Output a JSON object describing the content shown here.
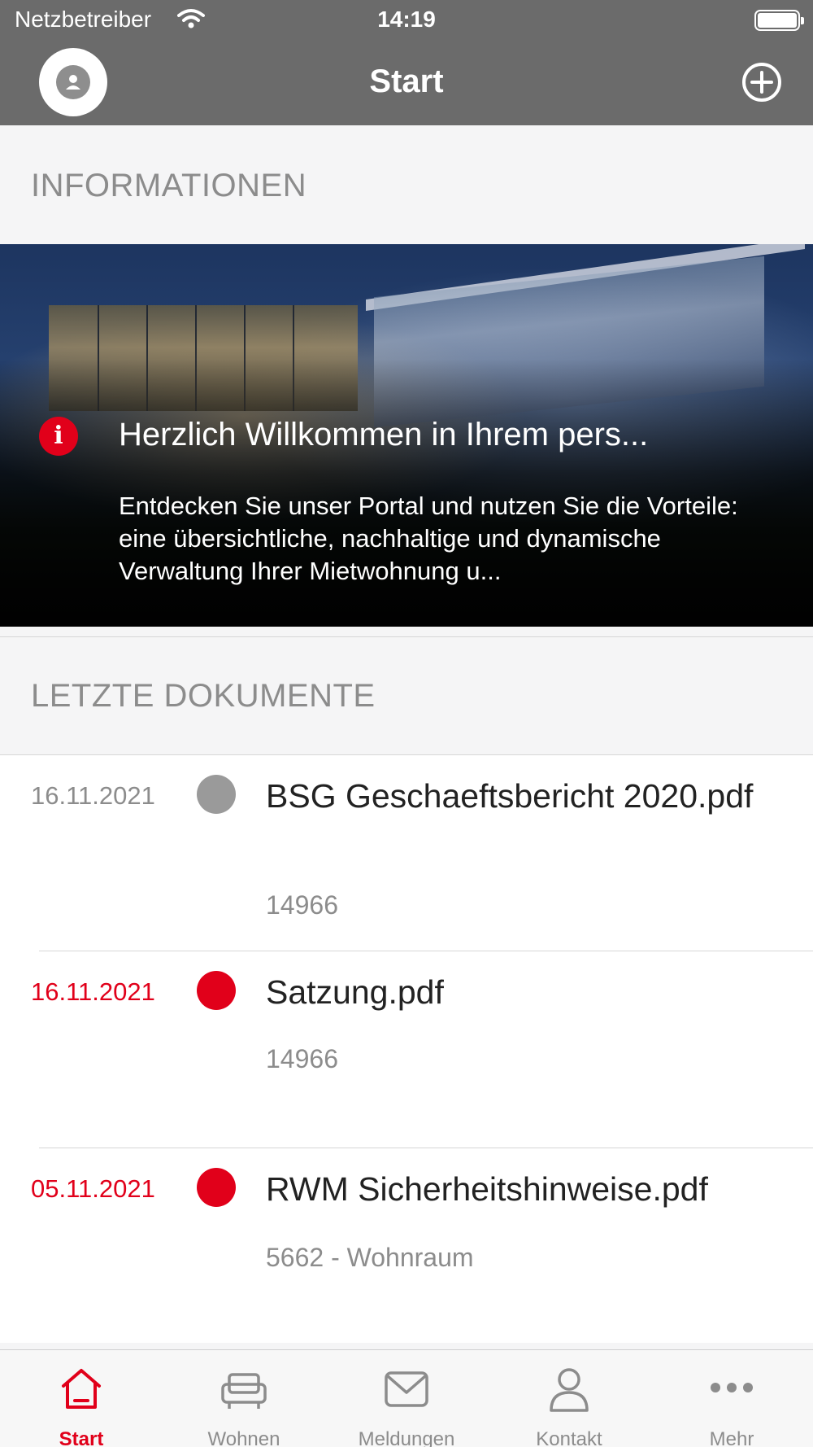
{
  "status_bar": {
    "carrier": "Netzbetreiber",
    "time": "14:19"
  },
  "nav": {
    "title": "Start"
  },
  "sections": {
    "info_header": "INFORMATIONEN",
    "docs_header": "LETZTE DOKUMENTE"
  },
  "banner": {
    "headline": "Herzlich Willkommen in Ihrem pers...",
    "body": "Entdecken Sie unser Portal und nutzen Sie die Vorteile: eine übersichtliche, nachhaltige und dynamische Verwaltung Ihrer Mietwohnung u..."
  },
  "documents": [
    {
      "date": "16.11.2021",
      "name": "BSG Geschaeftsbericht 2020.pdf",
      "sub": "14966",
      "status_color": "#9a9a9a",
      "date_color": "#8c8c8c"
    },
    {
      "date": "16.11.2021",
      "name": "Satzung.pdf",
      "sub": "14966",
      "status_color": "#e1001a",
      "date_color": "#e1001a"
    },
    {
      "date": "05.11.2021",
      "name": "RWM Sicherheitshinweise.pdf",
      "sub": "5662 - Wohnraum",
      "status_color": "#e1001a",
      "date_color": "#e1001a"
    }
  ],
  "tabs": [
    {
      "label": "Start",
      "icon": "home-icon",
      "active": true
    },
    {
      "label": "Wohnen",
      "icon": "sofa-icon",
      "active": false
    },
    {
      "label": "Meldungen",
      "icon": "envelope-icon",
      "active": false
    },
    {
      "label": "Kontakt",
      "icon": "person-icon",
      "active": false
    },
    {
      "label": "Mehr",
      "icon": "more-dots-icon",
      "active": false
    }
  ],
  "colors": {
    "accent": "#e1001a",
    "nav_background": "#6b6b6b",
    "inactive": "#8c8c8c"
  }
}
